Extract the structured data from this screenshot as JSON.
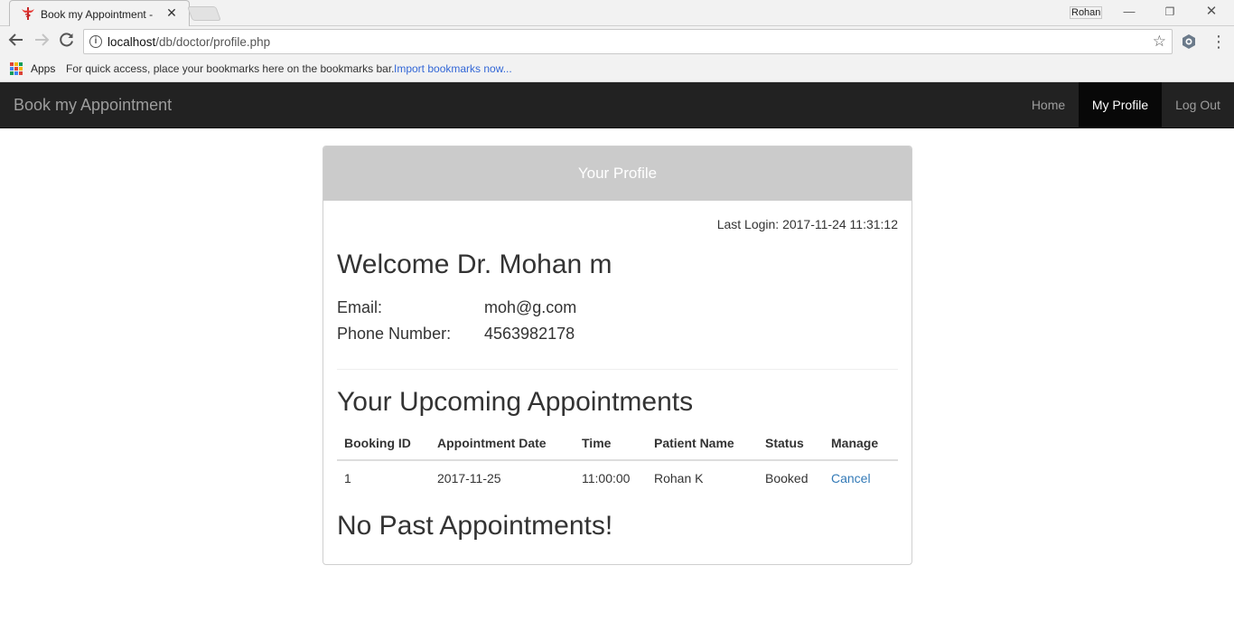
{
  "browser": {
    "tab_title": "Book my Appointment - ",
    "profile_name": "Rohan",
    "url_host": "localhost",
    "url_path": "/db/doctor/profile.php",
    "apps_label": "Apps",
    "bookmarks_hint": "For quick access, place your bookmarks here on the bookmarks bar.",
    "import_bookmarks": "Import bookmarks now..."
  },
  "navbar": {
    "brand": "Book my Appointment",
    "items": [
      {
        "label": "Home"
      },
      {
        "label": "My Profile"
      },
      {
        "label": "Log Out"
      }
    ]
  },
  "panel": {
    "heading": "Your Profile",
    "last_login": "Last Login: 2017-11-24 11:31:12",
    "welcome": "Welcome Dr. Mohan m",
    "email_label": "Email:",
    "email_value": "moh@g.com",
    "phone_label": "Phone Number:",
    "phone_value": "4563982178",
    "upcoming_title": "Your Upcoming Appointments",
    "table": {
      "headers": [
        "Booking ID",
        "Appointment Date",
        "Time",
        "Patient Name",
        "Status",
        "Manage"
      ],
      "rows": [
        {
          "booking_id": "1",
          "date": "2017-11-25",
          "time": "11:00:00",
          "patient": "Rohan K",
          "status": "Booked",
          "manage": "Cancel"
        }
      ]
    },
    "past_title": "No Past Appointments!"
  }
}
